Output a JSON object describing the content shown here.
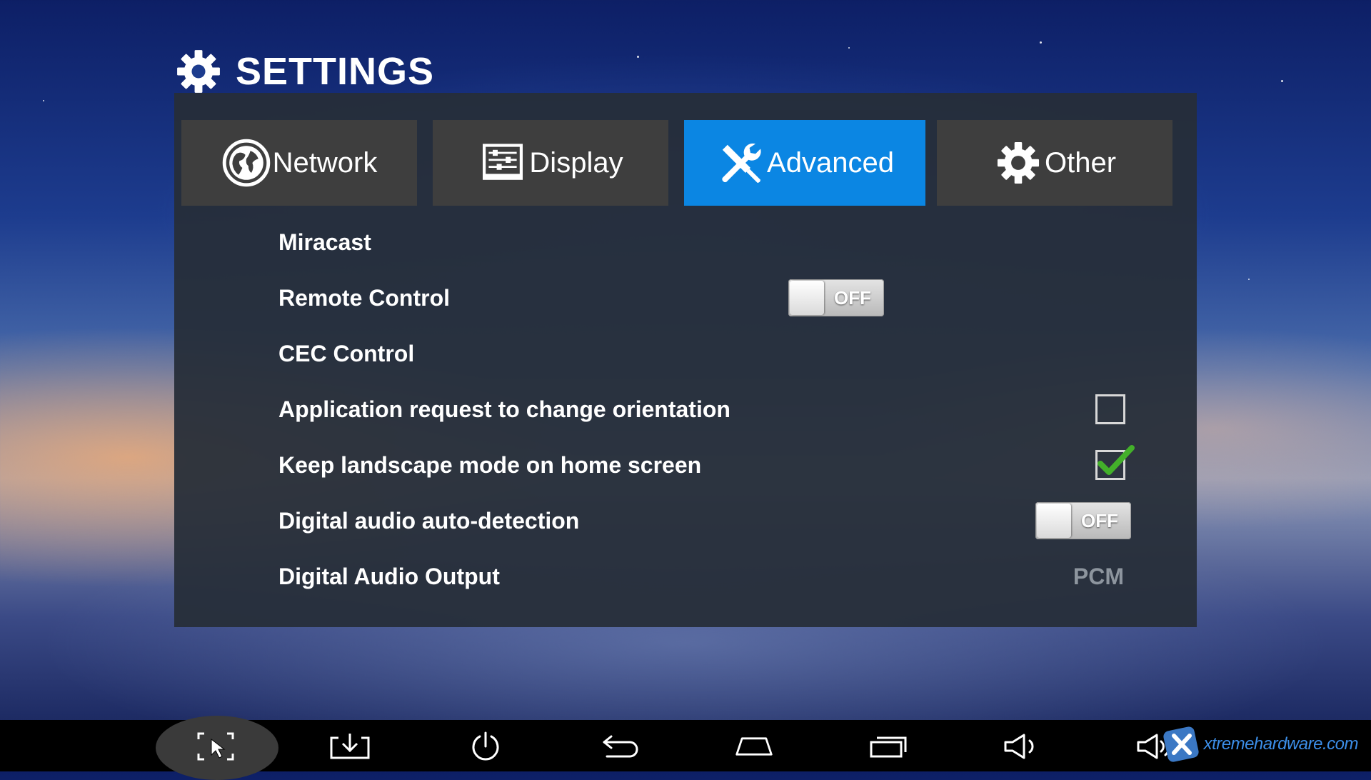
{
  "header": {
    "title": "SETTINGS",
    "icon": "gear-icon"
  },
  "tabs": [
    {
      "label": "Network",
      "icon": "globe-icon",
      "active": false
    },
    {
      "label": "Display",
      "icon": "display-sliders-icon",
      "active": false
    },
    {
      "label": "Advanced",
      "icon": "wrench-screwdriver-icon",
      "active": true
    },
    {
      "label": "Other",
      "icon": "gear-icon",
      "active": false
    }
  ],
  "settings": {
    "miracast": {
      "label": "Miracast"
    },
    "remote_control": {
      "label": "Remote Control",
      "toggle": "OFF"
    },
    "cec_control": {
      "label": "CEC Control"
    },
    "app_orientation": {
      "label": "Application request to change orientation",
      "checked": false
    },
    "keep_landscape": {
      "label": "Keep landscape mode on home screen",
      "checked": true
    },
    "digital_audio_detect": {
      "label": "Digital audio auto-detection",
      "toggle": "OFF"
    },
    "digital_audio_output": {
      "label": "Digital Audio Output",
      "value": "PCM"
    }
  },
  "navbar": {
    "buttons": [
      "screenshot-icon",
      "download-icon",
      "power-icon",
      "back-icon",
      "home-icon",
      "recent-apps-icon",
      "volume-down-icon",
      "volume-up-icon"
    ]
  },
  "watermark": {
    "text": "xtremehardware.com"
  },
  "colors": {
    "accent": "#0b86e3",
    "panel": "#262e38",
    "tab": "#3e3e3e",
    "checkmark": "#43b02a"
  }
}
